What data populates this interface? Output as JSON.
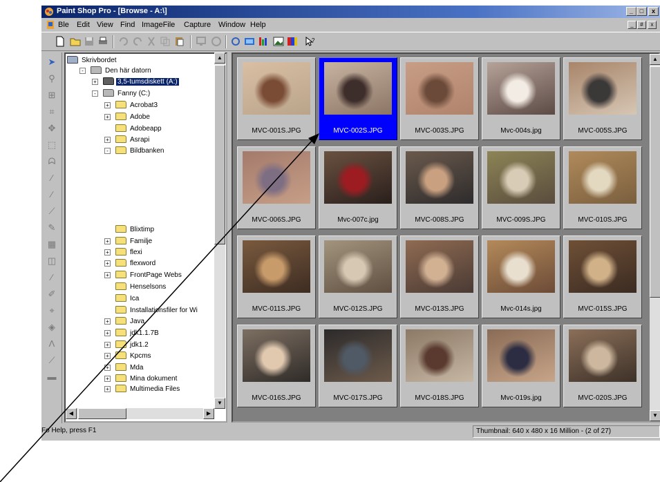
{
  "window": {
    "title": "Paint Shop Pro - [Browse - A:\\]",
    "controls": [
      "_",
      "□",
      "x"
    ],
    "mdi_controls": [
      "_",
      "#",
      "x"
    ]
  },
  "menu": [
    "Ble",
    "Edit",
    "View",
    "Find",
    "ImageFile",
    "Capture",
    "Window",
    "Help"
  ],
  "tree": {
    "nodes": [
      {
        "label": "Skrivbordet",
        "expander": ""
      },
      {
        "label": "Den här datorn",
        "expander": "-"
      },
      {
        "label": "3,5-tumsdiskett (A:)",
        "expander": "+",
        "selected": true
      },
      {
        "label": "Fanny (C:)",
        "expander": "-"
      },
      {
        "label": "Acrobat3",
        "expander": "+"
      },
      {
        "label": "Adobe",
        "expander": "+"
      },
      {
        "label": "Adobeapp",
        "expander": ""
      },
      {
        "label": "Asrapi",
        "expander": "+"
      },
      {
        "label": "Bildbanken",
        "expander": "-"
      },
      {
        "label": "Blixtimp",
        "expander": ""
      },
      {
        "label": "Familje",
        "expander": "+"
      },
      {
        "label": "flexi",
        "expander": "+"
      },
      {
        "label": "flexword",
        "expander": "+"
      },
      {
        "label": "FrontPage Webs",
        "expander": "+"
      },
      {
        "label": "Henselsons",
        "expander": ""
      },
      {
        "label": "Ica",
        "expander": ""
      },
      {
        "label": "Installationsfiler for Wi",
        "expander": ""
      },
      {
        "label": "Java",
        "expander": "+"
      },
      {
        "label": "jdk1.1.7B",
        "expander": "+"
      },
      {
        "label": "jdk1.2",
        "expander": "+"
      },
      {
        "label": "Kpcms",
        "expander": "+"
      },
      {
        "label": "Mda",
        "expander": "+"
      },
      {
        "label": "Mina dokument",
        "expander": "+"
      },
      {
        "label": "Multimedia Files",
        "expander": "+"
      }
    ]
  },
  "thumbnails": [
    {
      "label": "MVC-001S.JPG",
      "colors": [
        "#d9bfa4",
        "#7a4b35",
        "#b9a48a"
      ]
    },
    {
      "label": "MVC-002S.JPG",
      "colors": [
        "#c7b3a2",
        "#3e2e2b",
        "#8c7564"
      ],
      "selected": true
    },
    {
      "label": "MVC-003S.JPG",
      "colors": [
        "#c89d86",
        "#6b4a3a",
        "#b0846c"
      ]
    },
    {
      "label": "Mvc-004s.jpg",
      "colors": [
        "#b5a399",
        "#f3ece4",
        "#5c4a45"
      ]
    },
    {
      "label": "MVC-005S.JPG",
      "colors": [
        "#a8856a",
        "#3b3838",
        "#d6c6b4"
      ]
    },
    {
      "label": "MVC-006S.JPG",
      "colors": [
        "#a47a6b",
        "#7e6e83",
        "#c79f87"
      ]
    },
    {
      "label": "Mvc-007c.jpg",
      "colors": [
        "#6a5140",
        "#9c1c22",
        "#2a1f1c"
      ]
    },
    {
      "label": "MVC-008S.JPG",
      "colors": [
        "#6b5a4d",
        "#c9a080",
        "#2d2b2c"
      ]
    },
    {
      "label": "MVC-009S.JPG",
      "colors": [
        "#8d8456",
        "#d9ccb6",
        "#5a4c3d"
      ]
    },
    {
      "label": "MVC-010S.JPG",
      "colors": [
        "#b08a5b",
        "#e3d8c0",
        "#7a5f3e"
      ]
    },
    {
      "label": "MVC-011S.JPG",
      "colors": [
        "#7a5a3e",
        "#c79b6a",
        "#3d2c22"
      ]
    },
    {
      "label": "MVC-012S.JPG",
      "colors": [
        "#a3947e",
        "#d6c8b3",
        "#5e4f41"
      ]
    },
    {
      "label": "MVC-013S.JPG",
      "colors": [
        "#8f6b52",
        "#d2b193",
        "#4a3a34"
      ]
    },
    {
      "label": "Mvc-014s.jpg",
      "colors": [
        "#b48a5a",
        "#e9dfcf",
        "#6c4b37"
      ]
    },
    {
      "label": "MVC-015S.JPG",
      "colors": [
        "#6f5036",
        "#d0b188",
        "#3b2b22"
      ]
    },
    {
      "label": "MVC-016S.JPG",
      "colors": [
        "#7d6f62",
        "#e1c9b0",
        "#2f2b28"
      ]
    },
    {
      "label": "MVC-017S.JPG",
      "colors": [
        "#2c2a2b",
        "#4f5a66",
        "#6d5b4b"
      ]
    },
    {
      "label": "MVC-018S.JPG",
      "colors": [
        "#8c7966",
        "#5a3a2f",
        "#c6b7a4"
      ]
    },
    {
      "label": "Mvc-019s.jpg",
      "colors": [
        "#8a6b55",
        "#2c2d42",
        "#c7a58a"
      ]
    },
    {
      "label": "MVC-020S.JPG",
      "colors": [
        "#8b6f59",
        "#cdb89f",
        "#3d3128"
      ]
    }
  ],
  "status": {
    "help": "Fo Help, press F1",
    "info": "Thumbnail: 640 x 480 x 16 Million - (2 of 27)"
  },
  "colors": {
    "title_start": "#0a246a",
    "selection": "#0000ff",
    "tree_selection": "#0a246a"
  },
  "icons": [
    "app-icon",
    "new-icon",
    "open-icon",
    "save-icon",
    "print-icon",
    "browse-icon",
    "arrow-icon"
  ]
}
